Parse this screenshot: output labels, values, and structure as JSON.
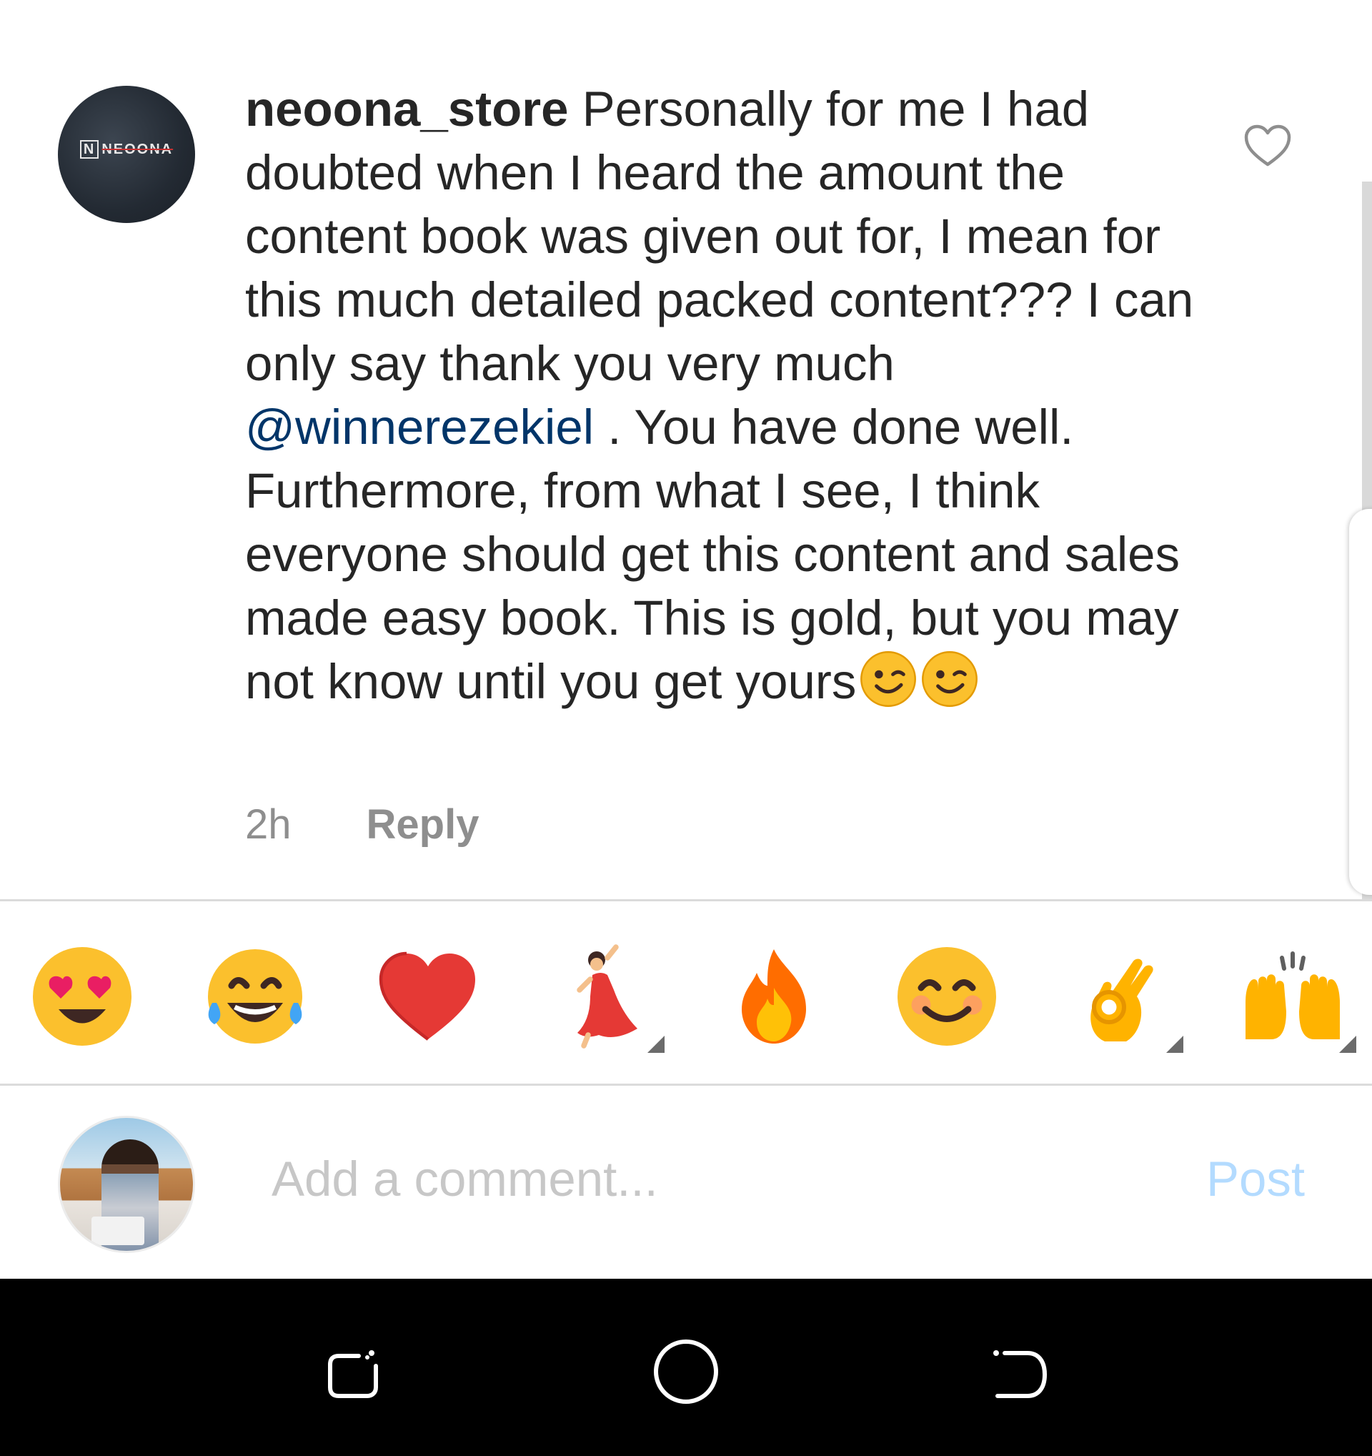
{
  "comment": {
    "username": "neoona_store",
    "text_before_mention": " Personally for me I had doubted when I heard the amount the content book was given out for, I mean for this much detailed packed content??? I can only say thank you very much ",
    "mention": "@winnerezekiel",
    "text_after_mention": " . You have done well.  Furthermore, from what I see, I think everyone  should get this content and sales made easy book. This is gold, but you may not know until you get yours",
    "trailing_emoji": [
      "winking-face",
      "winking-face"
    ],
    "avatar_logo_letter": "N",
    "avatar_logo_text": "NEOONA",
    "time": "2h",
    "reply_label": "Reply",
    "like_icon": "heart-outline-icon"
  },
  "quick_emojis": [
    {
      "name": "smiling-face-with-heart-eyes",
      "has_variants": false
    },
    {
      "name": "face-with-tears-of-joy",
      "has_variants": false
    },
    {
      "name": "red-heart",
      "has_variants": false
    },
    {
      "name": "woman-dancing",
      "has_variants": true
    },
    {
      "name": "fire",
      "has_variants": false
    },
    {
      "name": "smiling-face-with-smiling-eyes",
      "has_variants": false
    },
    {
      "name": "ok-hand",
      "has_variants": true
    },
    {
      "name": "raising-hands",
      "has_variants": true
    }
  ],
  "composer": {
    "placeholder": "Add a comment...",
    "value": "",
    "post_label": "Post"
  },
  "navbar": {
    "buttons": [
      "recent-apps-icon",
      "home-icon",
      "back-icon"
    ]
  },
  "colors": {
    "text": "#262626",
    "secondary_text": "#8e8e8e",
    "mention": "#003569",
    "post_disabled": "#b3dbff",
    "placeholder": "#c7c7c7",
    "divider": "#dbdbdb"
  }
}
